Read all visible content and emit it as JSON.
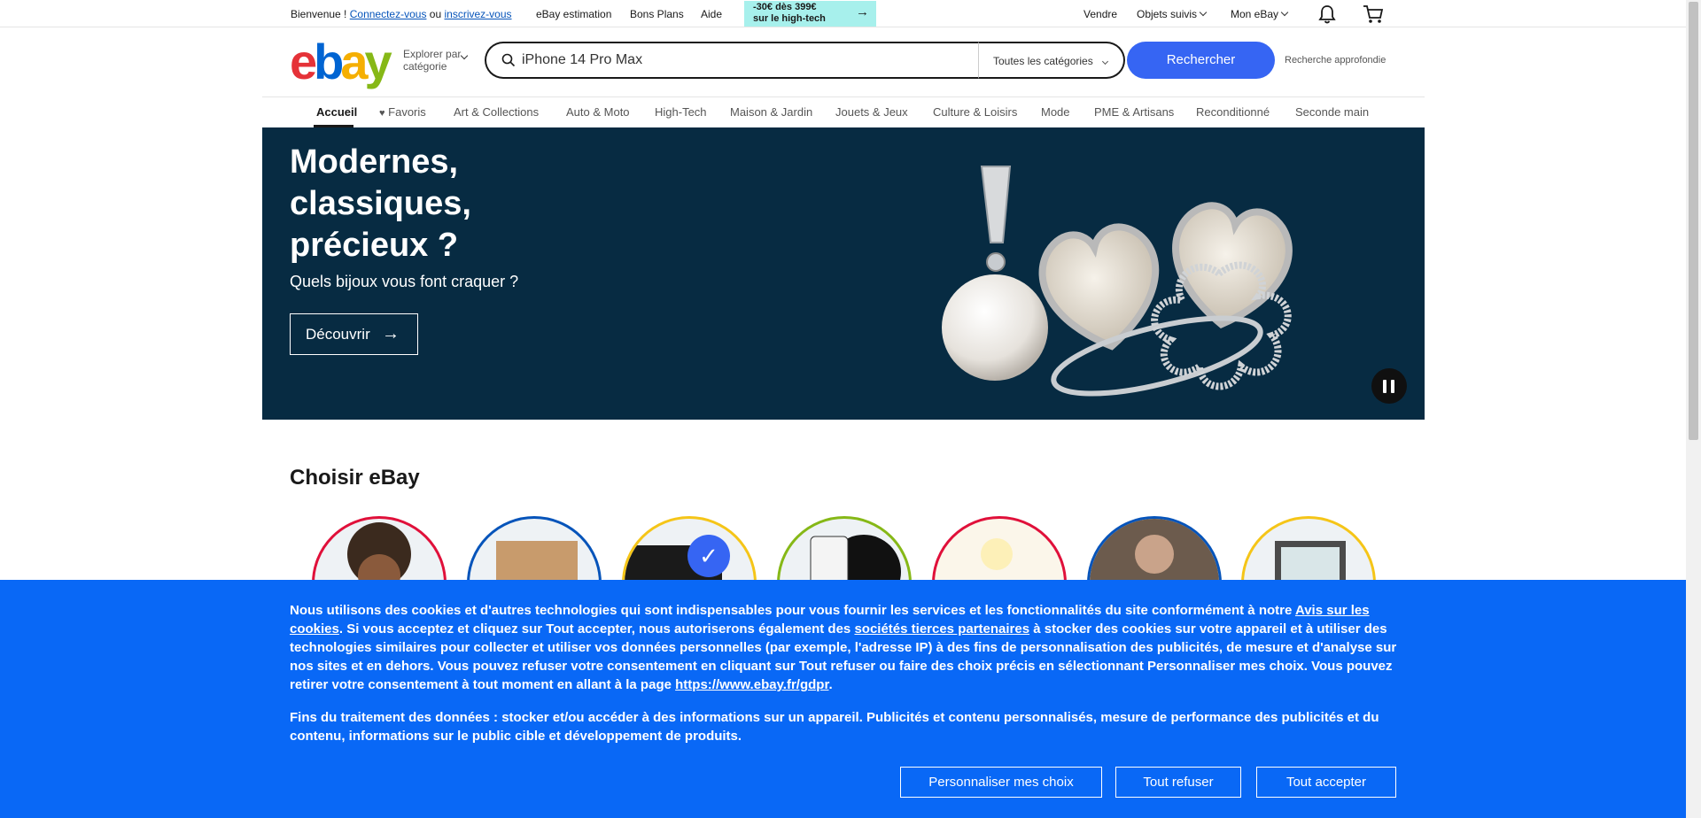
{
  "topbar": {
    "welcome": "Bienvenue !",
    "login": "Connectez-vous",
    "or": "ou",
    "register": "inscrivez-vous",
    "links": [
      "eBay estimation",
      "Bons Plans",
      "Aide"
    ],
    "promo_line1": "-30€ dès 399€",
    "promo_line2": "sur le high-tech",
    "sell": "Vendre",
    "watched": "Objets suivis",
    "my_ebay": "Mon eBay"
  },
  "header": {
    "explore_line1": "Explorer par",
    "explore_line2": "catégorie",
    "search_value": "iPhone 14 Pro Max",
    "category": "Toutes les catégories",
    "search_button": "Rechercher",
    "advanced": "Recherche approfondie"
  },
  "nav": {
    "items": [
      "Accueil",
      "Favoris",
      "Art & Collections",
      "Auto & Moto",
      "High-Tech",
      "Maison & Jardin",
      "Jouets & Jeux",
      "Culture & Loisirs",
      "Mode",
      "PME & Artisans",
      "Reconditionné",
      "Seconde main"
    ],
    "active": "Accueil"
  },
  "hero": {
    "title": "Modernes, classiques, précieux ?",
    "subtitle": "Quels bijoux vous font craquer ?",
    "cta": "Découvrir"
  },
  "section": {
    "title": "Choisir eBay",
    "circle_colors": [
      "#e0103a",
      "#0654ba",
      "#f5c518",
      "#86b817",
      "#e0103a",
      "#0654ba",
      "#f5c518"
    ]
  },
  "cookie": {
    "p1_a": "Nous utilisons des cookies et d'autres technologies qui sont indispensables pour vous fournir les services et les fonctionnalités du site conformément à notre ",
    "p1_link1": "Avis sur les cookies",
    "p1_b": ". Si vous acceptez et cliquez sur Tout accepter, nous autoriserons également des ",
    "p1_link2": "sociétés tierces partenaires",
    "p1_c": " à stocker des cookies sur votre appareil et à utiliser des technologies similaires pour collecter et utiliser vos données personnelles (par exemple, l'adresse IP) à des fins de personnalisation des publicités, de mesure et d'analyse sur nos sites et en dehors. Vous pouvez refuser votre consentement en cliquant sur Tout refuser ou faire des choix précis en sélectionnant Personnaliser mes choix. Vous pouvez retirer votre consentement à tout moment en allant à la page ",
    "p1_link3": "https://www.ebay.fr/gdpr",
    "p1_d": ".",
    "p2": "Fins du traitement des données : stocker et/ou accéder à des informations sur un appareil. Publicités et contenu personnalisés, mesure de performance des publicités et du contenu, informations sur le public cible et développement de produits.",
    "btn_customize": "Personnaliser mes choix",
    "btn_refuse": "Tout refuser",
    "btn_accept": "Tout accepter"
  },
  "colors": {
    "accent": "#3665f3",
    "banner": "#0968f6",
    "hero_bg": "#072b42"
  }
}
